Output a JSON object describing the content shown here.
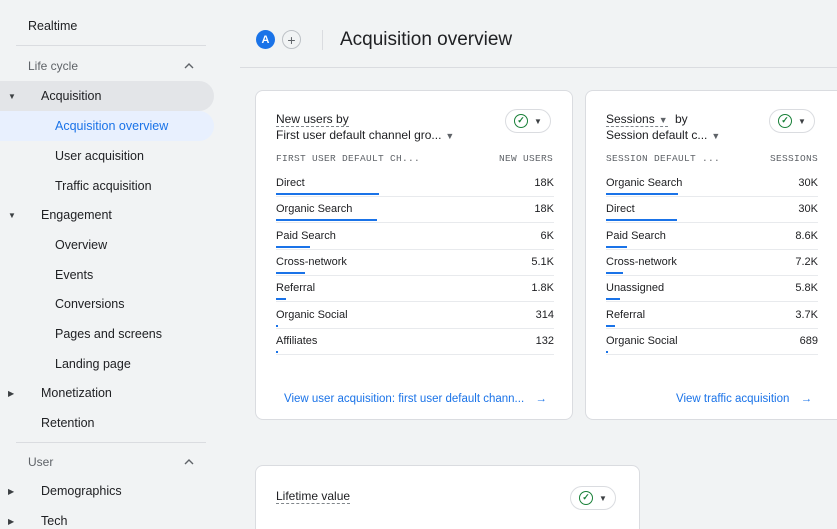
{
  "sidebar": {
    "realtime": "Realtime",
    "lifecycle_section": "Life cycle",
    "acquisition": "Acquisition",
    "acquisition_items": [
      "Acquisition overview",
      "User acquisition",
      "Traffic acquisition"
    ],
    "engagement": "Engagement",
    "engagement_items": [
      "Overview",
      "Events",
      "Conversions",
      "Pages and screens",
      "Landing page"
    ],
    "monetization": "Monetization",
    "retention": "Retention",
    "user_section": "User",
    "demographics": "Demographics",
    "tech": "Tech"
  },
  "header": {
    "avatar_letter": "A",
    "add_symbol": "+",
    "title": "Acquisition overview"
  },
  "card_new_users": {
    "title_line1": "New users by",
    "title_line2": "First user default channel gro...",
    "col_dim": "FIRST USER DEFAULT CH...",
    "col_metric": "NEW USERS",
    "rows": [
      {
        "label": "Direct",
        "value": "18K",
        "share": 1.0
      },
      {
        "label": "Organic Search",
        "value": "18K",
        "share": 0.98
      },
      {
        "label": "Paid Search",
        "value": "6K",
        "share": 0.33
      },
      {
        "label": "Cross-network",
        "value": "5.1K",
        "share": 0.28
      },
      {
        "label": "Referral",
        "value": "1.8K",
        "share": 0.1
      },
      {
        "label": "Organic Social",
        "value": "314",
        "share": 0.02
      },
      {
        "label": "Affiliates",
        "value": "132",
        "share": 0.01
      }
    ],
    "link": "View user acquisition: first user default chann...",
    "link_arrow": "→"
  },
  "card_sessions": {
    "title_line1_a": "Sessions",
    "title_line1_b": "by",
    "title_line2": "Session default c...",
    "col_dim": "SESSION DEFAULT ...",
    "col_metric": "SESSIONS",
    "rows": [
      {
        "label": "Organic Search",
        "value": "30K",
        "share": 1.0
      },
      {
        "label": "Direct",
        "value": "30K",
        "share": 0.98
      },
      {
        "label": "Paid Search",
        "value": "8.6K",
        "share": 0.29
      },
      {
        "label": "Cross-network",
        "value": "7.2K",
        "share": 0.24
      },
      {
        "label": "Unassigned",
        "value": "5.8K",
        "share": 0.19
      },
      {
        "label": "Referral",
        "value": "3.7K",
        "share": 0.12
      },
      {
        "label": "Organic Social",
        "value": "689",
        "share": 0.02
      }
    ],
    "link": "View traffic acquisition",
    "link_arrow": "→"
  },
  "card_lifetime": {
    "title": "Lifetime value"
  },
  "colors": {
    "accent": "#1a73e8",
    "success": "#188038",
    "background": "#f1f3f4"
  },
  "icons": {
    "check_filter": "check-circle-icon",
    "dropdown": "caret-down-icon",
    "section_toggle": "chevron-up-icon",
    "expand": "caret-right-icon",
    "link": "arrow-right-icon"
  }
}
